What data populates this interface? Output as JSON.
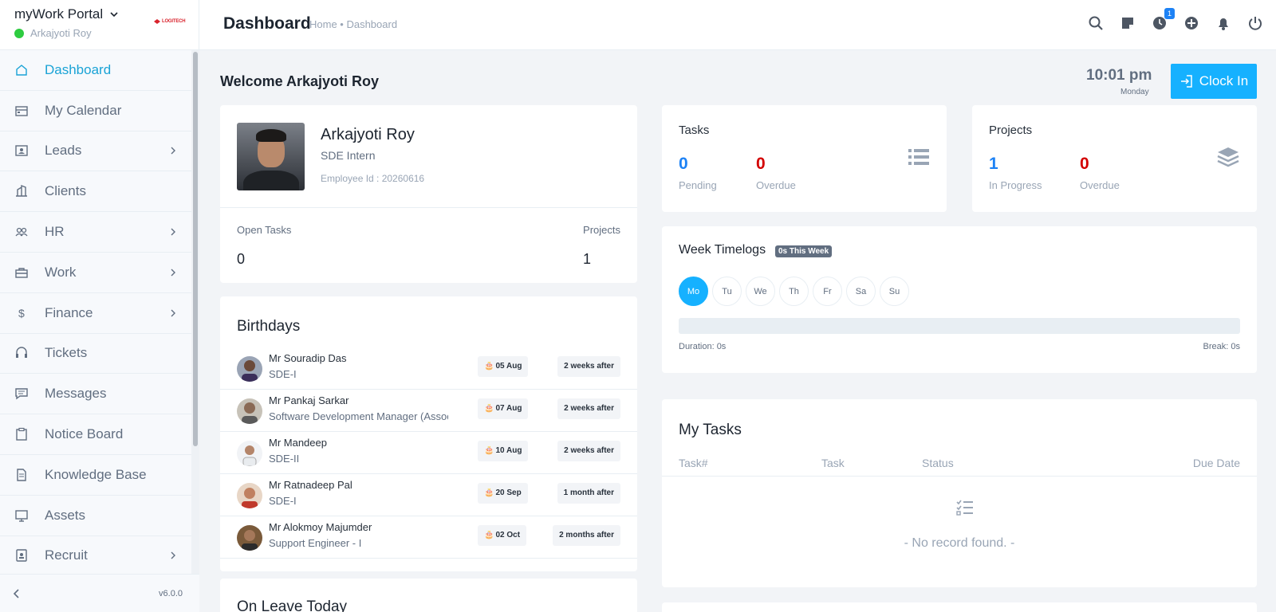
{
  "brand": {
    "title": "myWork Portal",
    "user": "Arkajyoti Roy",
    "logo_text": "LOGITECH",
    "version": "v6.0.0"
  },
  "nav": [
    {
      "label": "Dashboard",
      "icon": "home-icon",
      "active": true,
      "chevron": false
    },
    {
      "label": "My Calendar",
      "icon": "calendar-icon",
      "chevron": false
    },
    {
      "label": "Leads",
      "icon": "contact-card-icon",
      "chevron": true
    },
    {
      "label": "Clients",
      "icon": "building-icon",
      "chevron": false
    },
    {
      "label": "HR",
      "icon": "people-icon",
      "chevron": true
    },
    {
      "label": "Work",
      "icon": "briefcase-icon",
      "chevron": true
    },
    {
      "label": "Finance",
      "icon": "dollar-icon",
      "chevron": true
    },
    {
      "label": "Tickets",
      "icon": "headset-icon",
      "chevron": false
    },
    {
      "label": "Messages",
      "icon": "chat-icon",
      "chevron": false
    },
    {
      "label": "Notice Board",
      "icon": "clipboard-icon",
      "chevron": false
    },
    {
      "label": "Knowledge Base",
      "icon": "document-icon",
      "chevron": false
    },
    {
      "label": "Assets",
      "icon": "monitor-icon",
      "chevron": false
    },
    {
      "label": "Recruit",
      "icon": "badge-icon",
      "chevron": true
    }
  ],
  "header": {
    "title": "Dashboard",
    "breadcrumb": "Home • Dashboard",
    "timer_badge": "1",
    "icons": [
      "search-icon",
      "sticky-note-icon",
      "timer-icon",
      "add-circle-icon",
      "bell-icon",
      "power-icon"
    ]
  },
  "welcome": "Welcome Arkajyoti Roy",
  "clock": {
    "time": "10:01 pm",
    "day": "Monday",
    "button": "Clock In"
  },
  "profile": {
    "name": "Arkajyoti Roy",
    "role": "SDE Intern",
    "employee_id": "Employee Id : 20260616",
    "open_tasks_label": "Open Tasks",
    "open_tasks": "0",
    "projects_label": "Projects",
    "projects": "1"
  },
  "tasks_card": {
    "title": "Tasks",
    "pending": "0",
    "pending_label": "Pending",
    "overdue": "0",
    "overdue_label": "Overdue"
  },
  "projects_card": {
    "title": "Projects",
    "in_progress": "1",
    "in_progress_label": "In Progress",
    "overdue": "0",
    "overdue_label": "Overdue"
  },
  "week_timelogs": {
    "title": "Week Timelogs",
    "badge": "0s This Week",
    "days": [
      "Mo",
      "Tu",
      "We",
      "Th",
      "Fr",
      "Sa",
      "Su"
    ],
    "active_day": "Mo",
    "progress": 0,
    "duration": "Duration: 0s",
    "break": "Break: 0s"
  },
  "birthdays": {
    "title": "Birthdays",
    "items": [
      {
        "name": "Mr Souradip Das",
        "role": "SDE-I",
        "date": "05 Aug",
        "after": "2 weeks after"
      },
      {
        "name": "Mr Pankaj Sarkar",
        "role": "Software Development Manager (Assoc",
        "date": "07 Aug",
        "after": "2 weeks after"
      },
      {
        "name": "Mr Mandeep",
        "role": "SDE-II",
        "date": "10 Aug",
        "after": "2 weeks after"
      },
      {
        "name": "Mr Ratnadeep Pal",
        "role": "SDE-I",
        "date": "20 Sep",
        "after": "1 month after"
      },
      {
        "name": "Mr Alokmoy Majumder",
        "role": "Support Engineer - I",
        "date": "02 Oct",
        "after": "2 months after"
      }
    ]
  },
  "my_tasks": {
    "title": "My Tasks",
    "columns": [
      "Task#",
      "Task",
      "Status",
      "Due Date"
    ],
    "empty": "- No record found. -"
  },
  "on_leave": {
    "title": "On Leave Today"
  },
  "colors": {
    "accent": "#16b1ff",
    "blue_num": "#1d82f5",
    "red_num": "#d30000",
    "online": "#2ecc40"
  }
}
